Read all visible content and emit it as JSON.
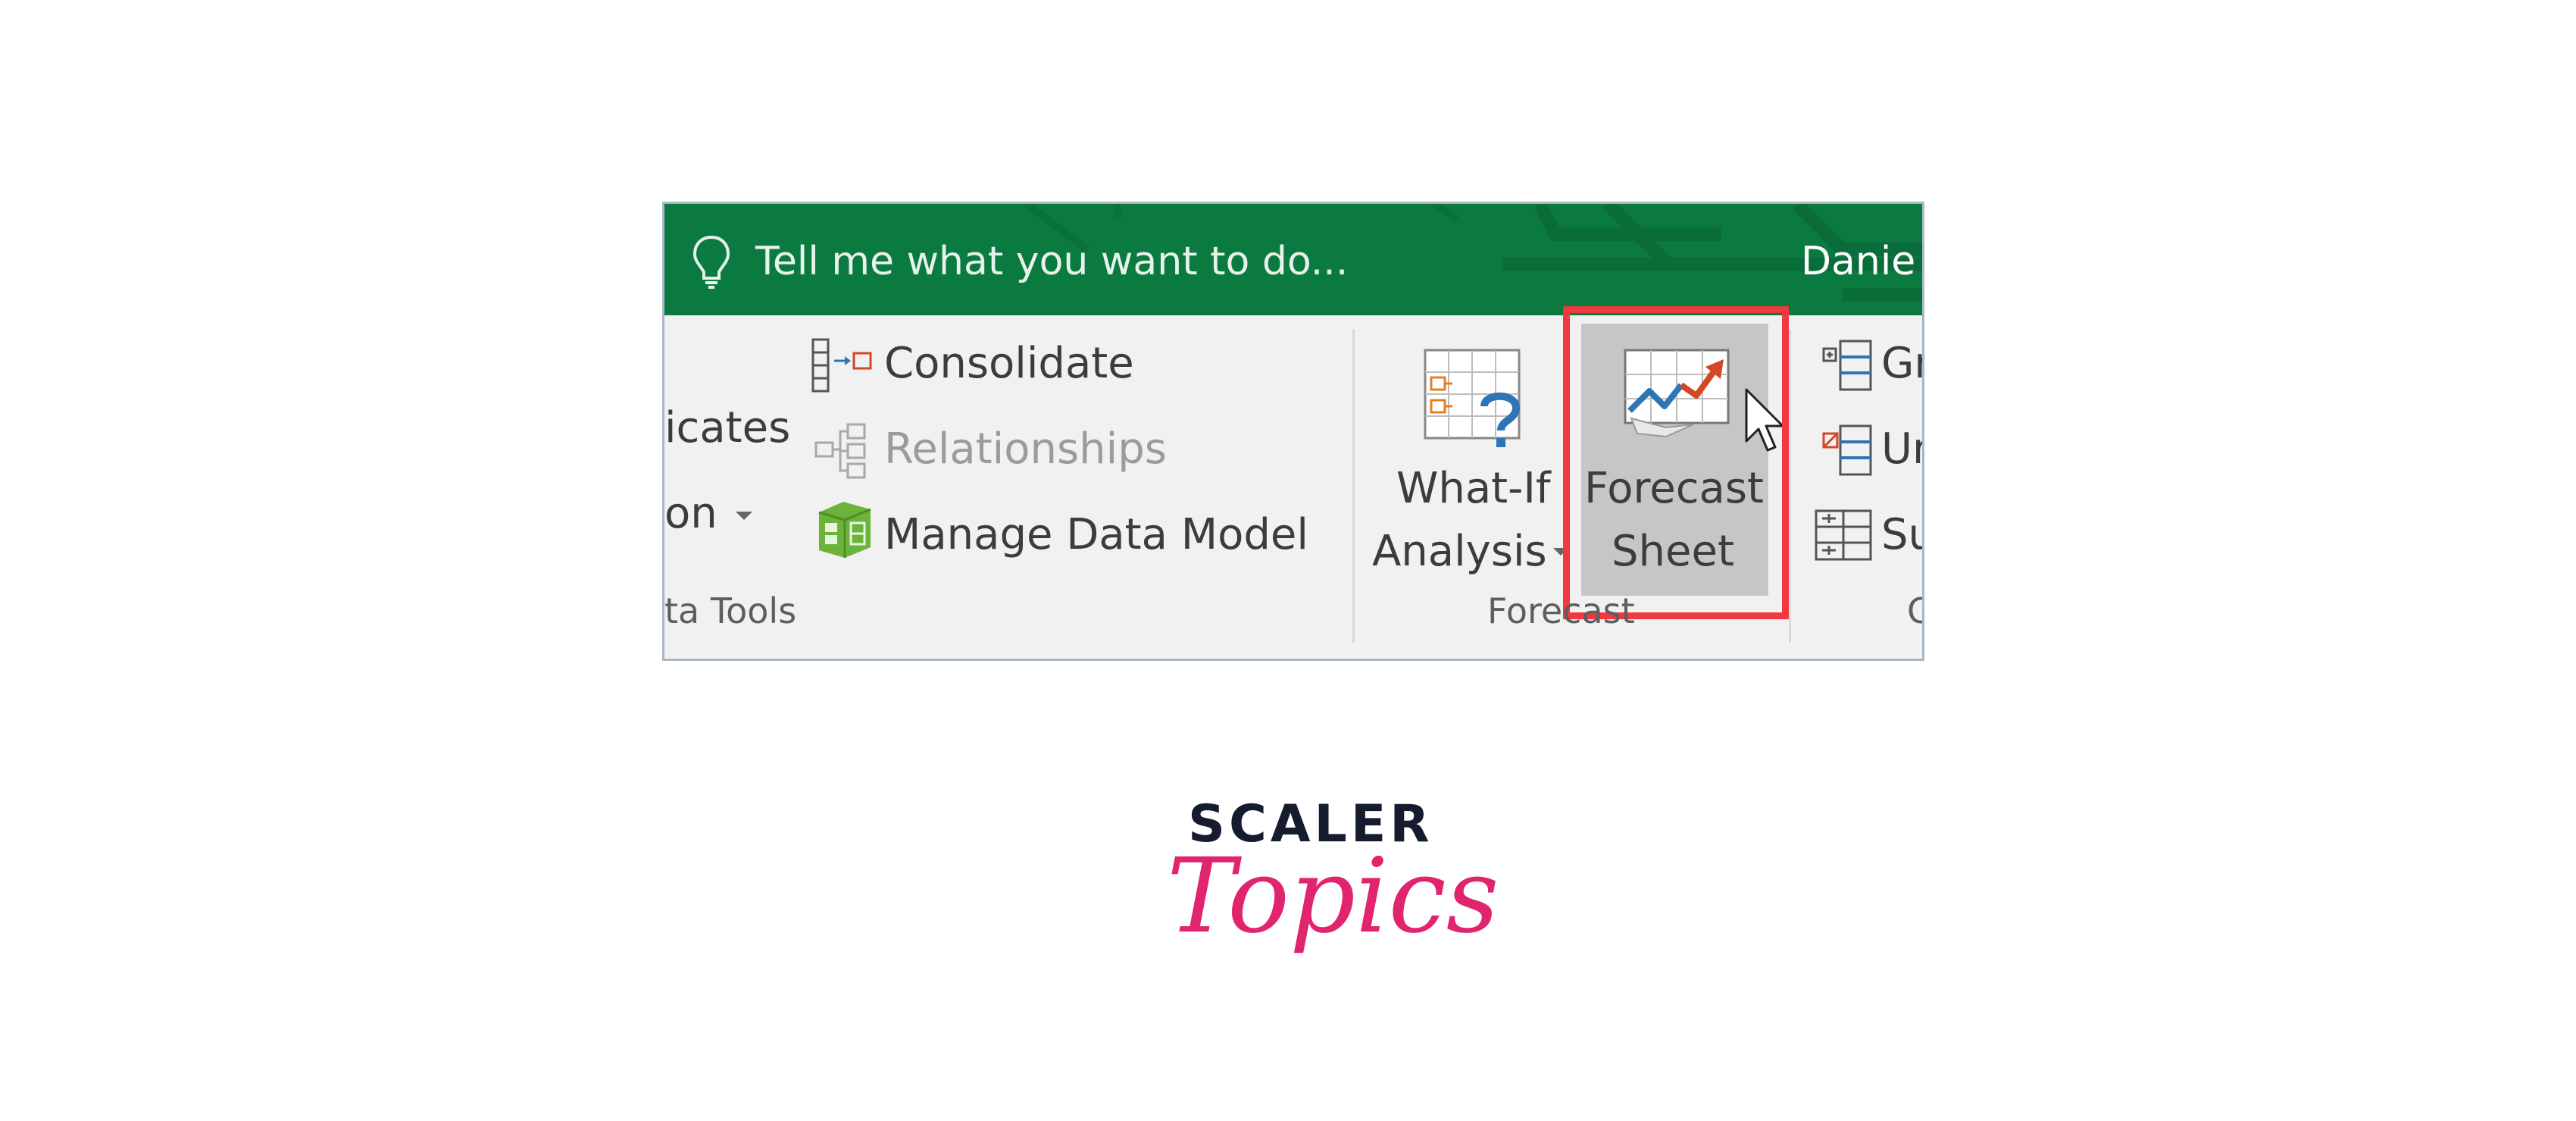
{
  "tell_me": {
    "placeholder": "Tell me what you want to do...",
    "icon": "lightbulb-icon"
  },
  "account": {
    "user_name": "Danie"
  },
  "ribbon": {
    "left_partial": {
      "duplicates": "icates",
      "validation": "on"
    },
    "commands": {
      "consolidate": "Consolidate",
      "relationships": "Relationships",
      "manage_data_model": "Manage Data Model"
    },
    "data_tools_group_label": "ta Tools",
    "what_if": {
      "line1": "What-If",
      "line2": "Analysis"
    },
    "forecast_sheet": {
      "line1": "Forecast",
      "line2": "Sheet"
    },
    "forecast_group_label": "Forecast",
    "outline_partial": {
      "group": "Gr",
      "ungroup": "Ur",
      "subtotal": "Su",
      "group_label": "C"
    }
  },
  "brand": {
    "line1": "SCALER",
    "line2": "Topics"
  },
  "colors": {
    "title_bar": "#0b7a41",
    "ribbon_bg": "#f1f1f1",
    "highlight": "#f0383f",
    "pressed_button": "#c6c6c6",
    "brand_dark": "#141c2e",
    "brand_pink": "#e0246e"
  }
}
